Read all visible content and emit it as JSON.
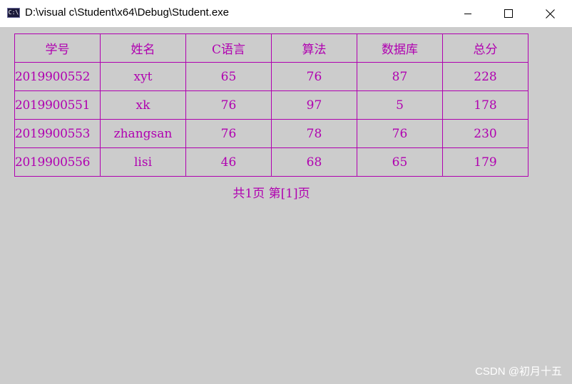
{
  "window": {
    "title": "D:\\visual c\\Student\\x64\\Debug\\Student.exe",
    "icon": "console-app-icon",
    "icon_glyph": "C:\\",
    "controls": {
      "minimize": "minimize-icon",
      "maximize": "maximize-icon",
      "close": "close-icon"
    }
  },
  "table": {
    "headers": [
      "学号",
      "姓名",
      "C语言",
      "算法",
      "数据库",
      "总分"
    ],
    "rows": [
      [
        "2019900552",
        "xyt",
        "65",
        "76",
        "87",
        "228"
      ],
      [
        "2019900551",
        "xk",
        "76",
        "97",
        "5",
        "178"
      ],
      [
        "2019900553",
        "zhangsan",
        "76",
        "78",
        "76",
        "230"
      ],
      [
        "2019900556",
        "lisi",
        "46",
        "68",
        "65",
        "179"
      ]
    ],
    "text_color": "#b000b0",
    "border_color": "#b000b0"
  },
  "pagination": {
    "text": "共1页 第[1]页"
  },
  "watermark": {
    "text": "CSDN @初月十五"
  },
  "colors": {
    "console_background": "#cccccc",
    "titlebar_background": "#ffffff"
  }
}
